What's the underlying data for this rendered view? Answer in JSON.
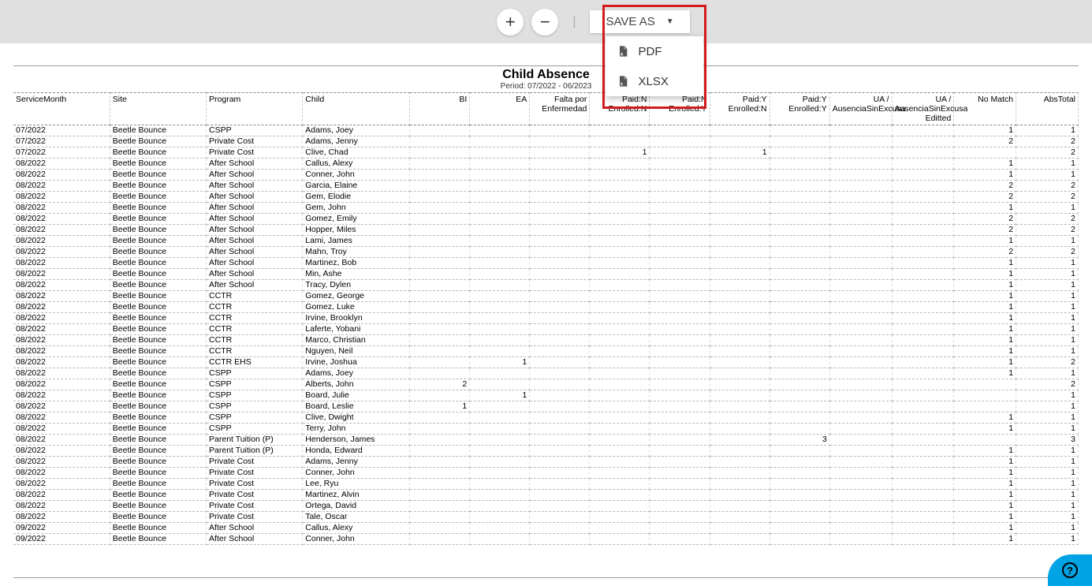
{
  "toolbar": {
    "plus": "+",
    "minus": "−",
    "separator": "|",
    "saveas_label": "SAVE AS",
    "caret": "▼"
  },
  "dropdown": {
    "pdf_label": "PDF",
    "xlsx_label": "XLSX"
  },
  "report": {
    "title": "Child Absence",
    "period": "Period: 07/2022 - 06/2023"
  },
  "columns": [
    "ServiceMonth",
    "Site",
    "Program",
    "Child",
    "BI",
    "EA",
    "Falta por Enfermedad",
    "Paid:N Enrolled:N",
    "Paid:N Enrolled:Y",
    "Paid:Y Enrolled:N",
    "Paid:Y Enrolled:Y",
    "UA / AusenciaSinExcusa",
    "UA / AusenciaSinExcusa Editted",
    "No Match",
    "AbsTotal"
  ],
  "rows": [
    {
      "m": "07/2022",
      "s": "Beetle Bounce",
      "p": "CSPP",
      "c": "Adams, Joey",
      "nm": "1",
      "t": "1"
    },
    {
      "m": "07/2022",
      "s": "Beetle Bounce",
      "p": "Private Cost",
      "c": "Adams, Jenny",
      "nm": "2",
      "t": "2"
    },
    {
      "m": "07/2022",
      "s": "Beetle Bounce",
      "p": "Private Cost",
      "c": "Clive, Chad",
      "pnn": "1",
      "pyn": "1",
      "t": "2"
    },
    {
      "m": "08/2022",
      "s": "Beetle Bounce",
      "p": "After School",
      "c": "Callus, Alexy",
      "nm": "1",
      "t": "1"
    },
    {
      "m": "08/2022",
      "s": "Beetle Bounce",
      "p": "After School",
      "c": "Conner, John",
      "nm": "1",
      "t": "1"
    },
    {
      "m": "08/2022",
      "s": "Beetle Bounce",
      "p": "After School",
      "c": "Garcia, Elaine",
      "nm": "2",
      "t": "2"
    },
    {
      "m": "08/2022",
      "s": "Beetle Bounce",
      "p": "After School",
      "c": "Gem, Elodie",
      "nm": "2",
      "t": "2"
    },
    {
      "m": "08/2022",
      "s": "Beetle Bounce",
      "p": "After School",
      "c": "Gem, John",
      "nm": "1",
      "t": "1"
    },
    {
      "m": "08/2022",
      "s": "Beetle Bounce",
      "p": "After School",
      "c": "Gomez, Emily",
      "nm": "2",
      "t": "2"
    },
    {
      "m": "08/2022",
      "s": "Beetle Bounce",
      "p": "After School",
      "c": "Hopper, Miles",
      "nm": "2",
      "t": "2"
    },
    {
      "m": "08/2022",
      "s": "Beetle Bounce",
      "p": "After School",
      "c": "Lami, James",
      "nm": "1",
      "t": "1"
    },
    {
      "m": "08/2022",
      "s": "Beetle Bounce",
      "p": "After School",
      "c": "Mahn, Troy",
      "nm": "2",
      "t": "2"
    },
    {
      "m": "08/2022",
      "s": "Beetle Bounce",
      "p": "After School",
      "c": "Martinez, Bob",
      "nm": "1",
      "t": "1"
    },
    {
      "m": "08/2022",
      "s": "Beetle Bounce",
      "p": "After School",
      "c": "Min, Ashe",
      "nm": "1",
      "t": "1"
    },
    {
      "m": "08/2022",
      "s": "Beetle Bounce",
      "p": "After School",
      "c": "Tracy, Dylen",
      "nm": "1",
      "t": "1"
    },
    {
      "m": "08/2022",
      "s": "Beetle Bounce",
      "p": "CCTR",
      "c": "Gomez, George",
      "nm": "1",
      "t": "1"
    },
    {
      "m": "08/2022",
      "s": "Beetle Bounce",
      "p": "CCTR",
      "c": "Gomez, Luke",
      "nm": "1",
      "t": "1"
    },
    {
      "m": "08/2022",
      "s": "Beetle Bounce",
      "p": "CCTR",
      "c": "Irvine, Brooklyn",
      "nm": "1",
      "t": "1"
    },
    {
      "m": "08/2022",
      "s": "Beetle Bounce",
      "p": "CCTR",
      "c": "Laferte, Yobani",
      "nm": "1",
      "t": "1"
    },
    {
      "m": "08/2022",
      "s": "Beetle Bounce",
      "p": "CCTR",
      "c": "Marco, Christian",
      "nm": "1",
      "t": "1"
    },
    {
      "m": "08/2022",
      "s": "Beetle Bounce",
      "p": "CCTR",
      "c": "Nguyen, Neil",
      "nm": "1",
      "t": "1"
    },
    {
      "m": "08/2022",
      "s": "Beetle Bounce",
      "p": "CCTR EHS",
      "c": "Irvine, Joshua",
      "ea": "1",
      "nm": "1",
      "t": "2"
    },
    {
      "m": "08/2022",
      "s": "Beetle Bounce",
      "p": "CSPP",
      "c": "Adams, Joey",
      "nm": "1",
      "t": "1"
    },
    {
      "m": "08/2022",
      "s": "Beetle Bounce",
      "p": "CSPP",
      "c": "Alberts, John",
      "bi": "2",
      "t": "2"
    },
    {
      "m": "08/2022",
      "s": "Beetle Bounce",
      "p": "CSPP",
      "c": "Board, Julie",
      "ea": "1",
      "t": "1"
    },
    {
      "m": "08/2022",
      "s": "Beetle Bounce",
      "p": "CSPP",
      "c": "Board, Leslie",
      "bi": "1",
      "t": "1"
    },
    {
      "m": "08/2022",
      "s": "Beetle Bounce",
      "p": "CSPP",
      "c": "Clive, Dwight",
      "nm": "1",
      "t": "1"
    },
    {
      "m": "08/2022",
      "s": "Beetle Bounce",
      "p": "CSPP",
      "c": "Terry, John",
      "nm": "1",
      "t": "1"
    },
    {
      "m": "08/2022",
      "s": "Beetle Bounce",
      "p": "Parent Tuition (P)",
      "c": "Henderson, James",
      "pyy": "3",
      "t": "3"
    },
    {
      "m": "08/2022",
      "s": "Beetle Bounce",
      "p": "Parent Tuition (P)",
      "c": "Honda, Edward",
      "nm": "1",
      "t": "1"
    },
    {
      "m": "08/2022",
      "s": "Beetle Bounce",
      "p": "Private Cost",
      "c": "Adams, Jenny",
      "nm": "1",
      "t": "1"
    },
    {
      "m": "08/2022",
      "s": "Beetle Bounce",
      "p": "Private Cost",
      "c": "Conner, John",
      "nm": "1",
      "t": "1"
    },
    {
      "m": "08/2022",
      "s": "Beetle Bounce",
      "p": "Private Cost",
      "c": "Lee, Ryu",
      "nm": "1",
      "t": "1"
    },
    {
      "m": "08/2022",
      "s": "Beetle Bounce",
      "p": "Private Cost",
      "c": "Martinez, Alvin",
      "nm": "1",
      "t": "1"
    },
    {
      "m": "08/2022",
      "s": "Beetle Bounce",
      "p": "Private Cost",
      "c": "Ortega, David",
      "nm": "1",
      "t": "1"
    },
    {
      "m": "08/2022",
      "s": "Beetle Bounce",
      "p": "Private Cost",
      "c": "Tale, Oscar",
      "nm": "1",
      "t": "1"
    },
    {
      "m": "09/2022",
      "s": "Beetle Bounce",
      "p": "After School",
      "c": "Callus, Alexy",
      "nm": "1",
      "t": "1"
    },
    {
      "m": "09/2022",
      "s": "Beetle Bounce",
      "p": "After School",
      "c": "Conner, John",
      "nm": "1",
      "t": "1"
    }
  ],
  "help": "?"
}
